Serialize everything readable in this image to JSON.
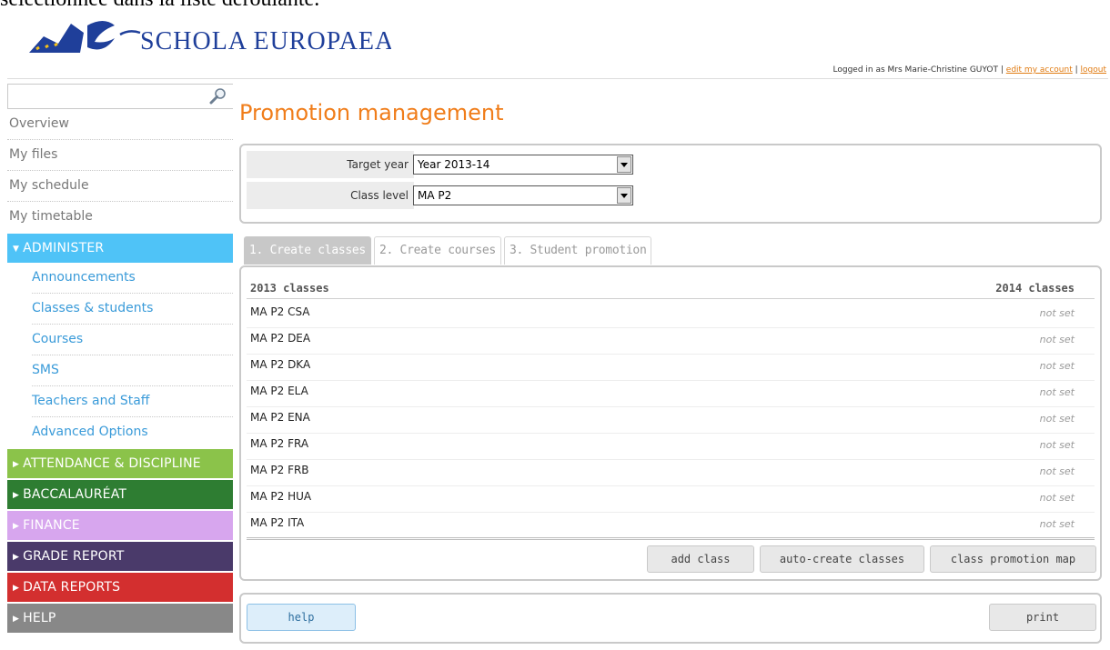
{
  "document_text": "sélectionnée dans la liste déroulante.",
  "logo": {
    "text": "SCHOLA EUROPAEA"
  },
  "user": {
    "logged_in_text": "Logged in as Mrs Marie-Christine GUYOT",
    "separator": "|",
    "edit_account": "edit my account",
    "logout": "logout"
  },
  "search": {
    "value": "",
    "placeholder": ""
  },
  "nav": {
    "items": [
      "Overview",
      "My files",
      "My schedule",
      "My timetable"
    ],
    "administer": {
      "label": "ADMINISTER",
      "color": "#4fc3f7",
      "items": [
        "Announcements",
        "Classes & students",
        "Courses",
        "SMS",
        "Teachers and Staff",
        "Advanced Options"
      ]
    },
    "sections": [
      {
        "label": "ATTENDANCE & DISCIPLINE",
        "color": "#8bc34a"
      },
      {
        "label": "BACCALAURÉAT",
        "color": "#2e7d32"
      },
      {
        "label": "FINANCE",
        "color": "#d7a6ee"
      },
      {
        "label": "GRADE REPORT",
        "color": "#4a3a6a"
      },
      {
        "label": "DATA REPORTS",
        "color": "#d32f2f"
      },
      {
        "label": "HELP",
        "color": "#888888"
      }
    ]
  },
  "page": {
    "title": "Promotion management"
  },
  "filters": {
    "target_year_label": "Target year",
    "target_year_value": "Year 2013-14",
    "class_level_label": "Class level",
    "class_level_value": "MA P2"
  },
  "tabs": [
    {
      "label": "1. Create classes",
      "active": true
    },
    {
      "label": "2. Create courses",
      "active": false
    },
    {
      "label": "3. Student promotion",
      "active": false
    }
  ],
  "table": {
    "col_left": "2013 classes",
    "col_right": "2014 classes",
    "rows": [
      {
        "class": "MA P2 CSA",
        "target": "not set"
      },
      {
        "class": "MA P2 DEA",
        "target": "not set"
      },
      {
        "class": "MA P2 DKA",
        "target": "not set"
      },
      {
        "class": "MA P2 ELA",
        "target": "not set"
      },
      {
        "class": "MA P2 ENA",
        "target": "not set"
      },
      {
        "class": "MA P2 FRA",
        "target": "not set"
      },
      {
        "class": "MA P2 FRB",
        "target": "not set"
      },
      {
        "class": "MA P2 HUA",
        "target": "not set"
      },
      {
        "class": "MA P2 ITA",
        "target": "not set"
      }
    ]
  },
  "buttons": {
    "add_class": "add class",
    "auto_create": "auto-create classes",
    "promotion_map": "class promotion map",
    "help": "help",
    "print": "print"
  }
}
